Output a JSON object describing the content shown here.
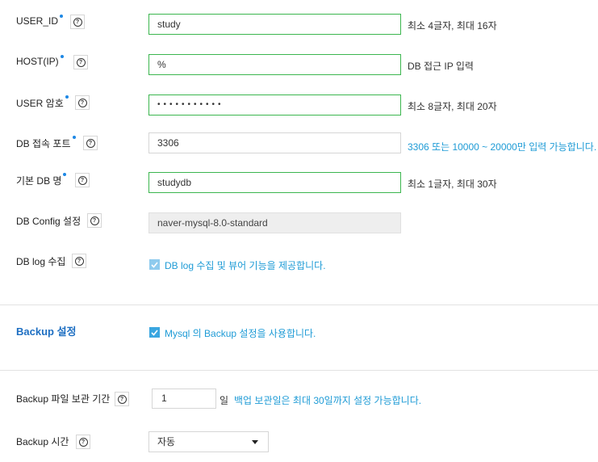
{
  "fields": {
    "user_id": {
      "label": "USER_ID",
      "value": "study",
      "hint": "최소 4글자, 최대 16자"
    },
    "host": {
      "label": "HOST(IP)",
      "value": "%",
      "hint": "DB 접근 IP 입력"
    },
    "password": {
      "label": "USER 암호",
      "value": "•••••••••••",
      "hint": "최소 8글자, 최대 20자"
    },
    "port": {
      "label": "DB 접속 포트",
      "value": "3306",
      "hint": "3306 또는 10000 ~ 20000만 입력 가능합니다."
    },
    "db_name": {
      "label": "기본 DB 명",
      "value": "studydb",
      "hint": "최소 1글자, 최대 30자"
    },
    "db_config": {
      "label": "DB Config 설정",
      "value": "naver-mysql-8.0-standard"
    },
    "db_log": {
      "label": "DB log 수집",
      "checkbox_label": "DB log 수집 및 뷰어 기능을 제공합니다.",
      "checked": true
    }
  },
  "backup": {
    "title": "Backup 설정",
    "checkbox_label": "Mysql 의 Backup 설정을 사용합니다.",
    "checked": true,
    "retention": {
      "label": "Backup 파일 보관 기간",
      "value": "1",
      "unit": "일",
      "hint": "백업 보관일은 최대 30일까지 설정 가능합니다."
    },
    "time": {
      "label": "Backup 시간",
      "selected": "자동"
    }
  },
  "icons": {
    "help": "?",
    "check": "check-icon"
  },
  "colors": {
    "accent_blue": "#1e9bd6",
    "valid_green": "#3cb64f",
    "section_blue": "#1e6fc2"
  }
}
